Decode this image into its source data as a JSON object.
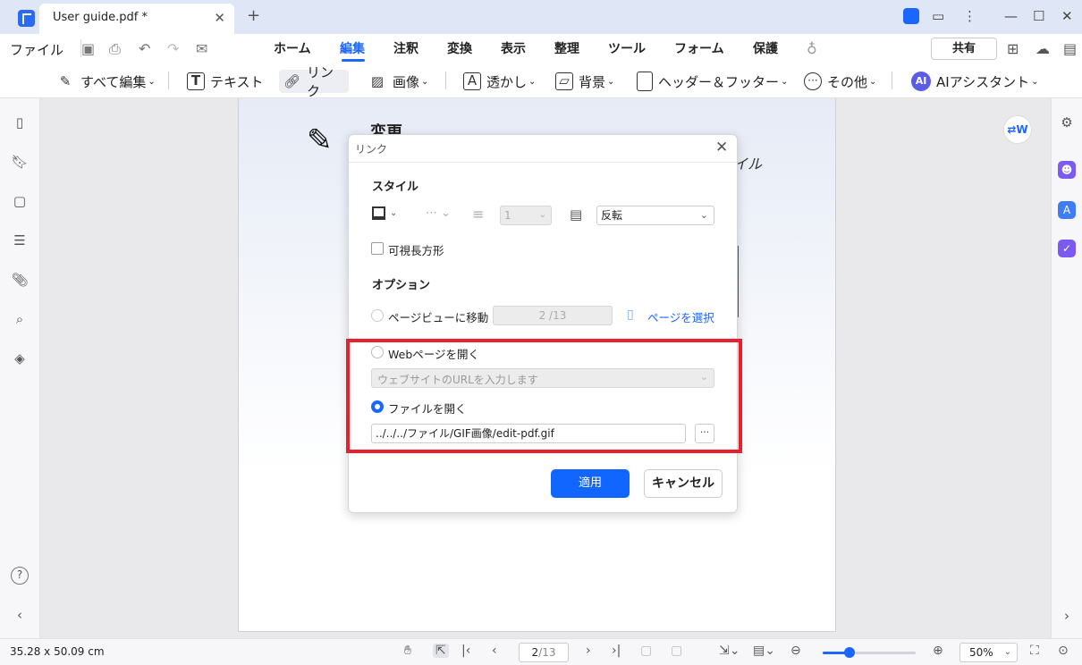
{
  "window": {
    "tab_title": "User guide.pdf *",
    "tab_close": "✕",
    "new_tab": "+"
  },
  "menu": {
    "file": "ファイル",
    "items": [
      "ホーム",
      "編集",
      "注釈",
      "変換",
      "表示",
      "整理",
      "ツール",
      "フォーム",
      "保護"
    ],
    "active": "編集",
    "share": "共有"
  },
  "toolbar": {
    "edit_all": "すべて編集",
    "text": "テキスト",
    "link": "リンク",
    "image": "画像",
    "watermark": "透かし",
    "background": "背景",
    "header_footer": "ヘッダー＆フッター",
    "other": "その他",
    "ai": "AIアシスタント"
  },
  "page": {
    "title": "変更",
    "text": "イル"
  },
  "dialog": {
    "title": "リンク",
    "style_label": "スタイル",
    "width_value": "1",
    "highlight_value": "反転",
    "visible_rect_label": "可視長方形",
    "options_label": "オプション",
    "page_view_label": "ページビューに移動",
    "page_view_value": "2 /13",
    "select_page_label": "ページを選択",
    "web_label": "Webページを開く",
    "url_placeholder": "ウェブサイトのURLを入力します",
    "file_label": "ファイルを開く",
    "file_path": "../../../ファイル/GIF画像/edit-pdf.gif",
    "browse": "···",
    "apply": "適用",
    "cancel": "キャンセル",
    "selected_option": "ファイルを開く"
  },
  "status": {
    "dimensions": "35.28 x 50.09 cm",
    "current_page": "2",
    "total_pages": "/13",
    "zoom": "50%",
    "zoom_level": 0.3
  },
  "colors": {
    "accent": "#1a66ff",
    "highlight_box": "#e8202d"
  }
}
